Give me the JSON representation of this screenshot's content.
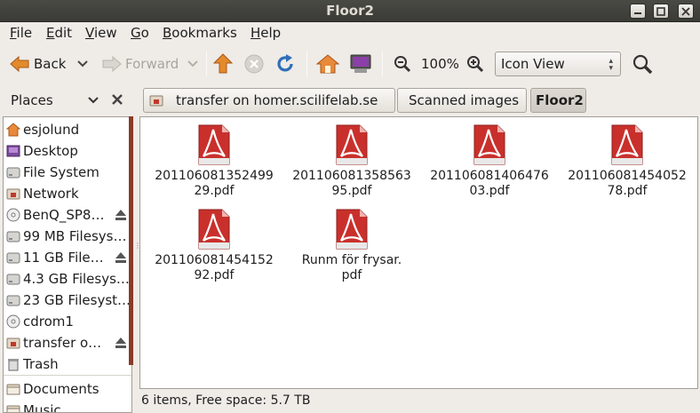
{
  "window": {
    "title": "Floor2"
  },
  "menu": [
    "File",
    "Edit",
    "View",
    "Go",
    "Bookmarks",
    "Help"
  ],
  "menu_mnemonics": [
    "F",
    "E",
    "V",
    "G",
    "B",
    "H"
  ],
  "toolbar": {
    "back": "Back",
    "forward": "Forward",
    "zoom": "100%",
    "view_mode": "Icon View"
  },
  "places": {
    "header": "Places"
  },
  "path": [
    "transfer on homer.scilifelab.se",
    "Scanned images",
    "Floor2"
  ],
  "sidebar": [
    {
      "label": "esjolund",
      "icon": "home-folder-icon"
    },
    {
      "label": "Desktop",
      "icon": "desktop-icon"
    },
    {
      "label": "File System",
      "icon": "drive-icon"
    },
    {
      "label": "Network",
      "icon": "network-folder-icon"
    },
    {
      "label": "BenQ_SP8…",
      "icon": "optical-disc-icon",
      "eject": true
    },
    {
      "label": "99 MB Filesys…",
      "icon": "drive-icon"
    },
    {
      "label": "11 GB File…",
      "icon": "drive-icon",
      "eject": true
    },
    {
      "label": "4.3 GB Filesys…",
      "icon": "drive-icon"
    },
    {
      "label": "23 GB Filesyst…",
      "icon": "drive-icon"
    },
    {
      "label": "cdrom1",
      "icon": "optical-disc-icon"
    },
    {
      "label": "transfer o…",
      "icon": "network-folder-icon",
      "eject": true
    },
    {
      "label": "Trash",
      "icon": "trash-icon"
    },
    {
      "label": "Documents",
      "icon": "folder-icon"
    },
    {
      "label": "Music",
      "icon": "folder-icon"
    }
  ],
  "files": [
    {
      "line1": "201106081352499",
      "line2": "29.pdf"
    },
    {
      "line1": "201106081358563",
      "line2": "95.pdf"
    },
    {
      "line1": "201106081406476",
      "line2": "03.pdf"
    },
    {
      "line1": "201106081454052",
      "line2": "78.pdf"
    },
    {
      "line1": "201106081454152",
      "line2": "92.pdf"
    },
    {
      "line1": "Runm för frysar.",
      "line2": "pdf"
    }
  ],
  "status": "6 items, Free space: 5.7 TB"
}
